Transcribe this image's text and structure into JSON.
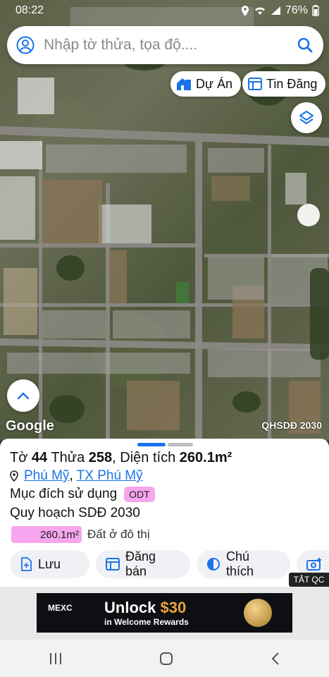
{
  "status_bar": {
    "time": "08:22",
    "battery": "76%"
  },
  "search": {
    "placeholder": "Nhập tờ thửa, tọa độ...."
  },
  "chips": {
    "project_label": "Dự Án",
    "listing_label": "Tin Đăng"
  },
  "map": {
    "attribution": "Google",
    "overlay_label": "QHSDĐ 2030"
  },
  "parcel": {
    "sheet_prefix": "Tờ",
    "sheet_no": "44",
    "plot_prefix": "Thửa",
    "plot_no": "258",
    "area_prefix": ", Diện tích",
    "area": "260.1m²",
    "location_ward": "Phú Mỹ",
    "location_sep": ", ",
    "location_town": "TX Phú Mỹ",
    "use_label": "Mục đích sử dụng",
    "use_code": "ODT",
    "plan_label": "Quy hoạch SDĐ 2030",
    "plan_area": "260.1m²",
    "plan_type": "Đất ở đô thị"
  },
  "actions": {
    "save": "Lưu",
    "post": "Đăng bán",
    "legend": "Chú thích"
  },
  "ad": {
    "close_label": "TẮT QC",
    "brand": "MEXC",
    "headline_main": "Unlock ",
    "headline_amount": "$30",
    "subline": "in Welcome Rewards"
  },
  "colors": {
    "accent": "#1a73e8",
    "badge": "#f6a5ee",
    "sheet_bg": "#ffffff"
  }
}
